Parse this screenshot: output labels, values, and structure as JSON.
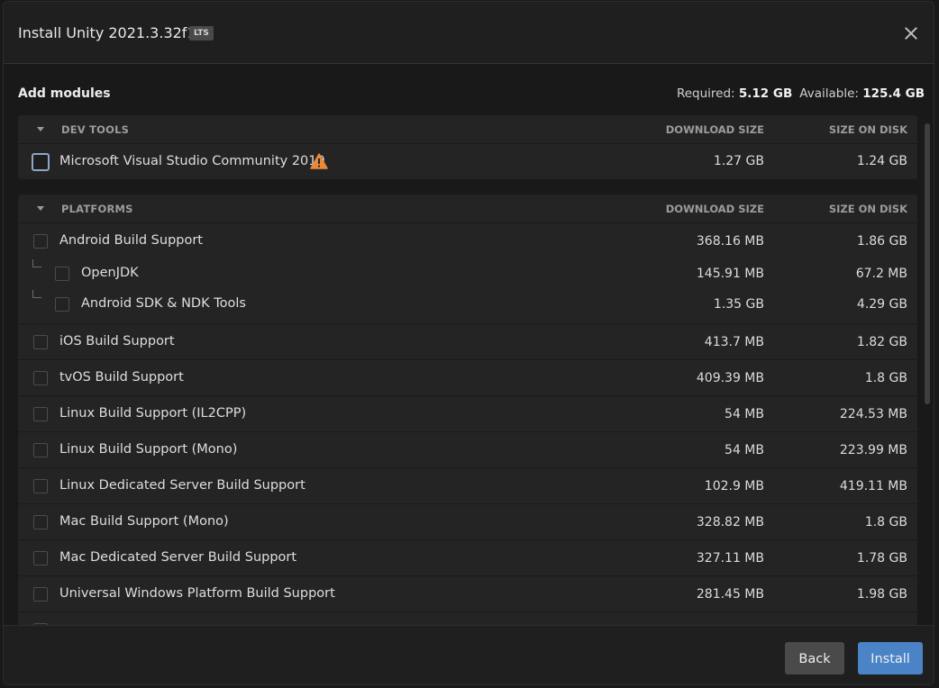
{
  "dialog": {
    "title": "Install Unity 2021.3.32f1",
    "badge": "LTS",
    "close_icon": "close-icon"
  },
  "summary": {
    "heading": "Add modules",
    "required_label": "Required:",
    "required_value": "5.12 GB",
    "available_label": "Available:",
    "available_value": "125.4 GB"
  },
  "dev_tools": {
    "header": "DEV TOOLS",
    "col_download": "DOWNLOAD SIZE",
    "col_disk": "SIZE ON DISK",
    "items": [
      {
        "label": "Microsoft Visual Studio Community 2019",
        "download": "1.27 GB",
        "disk": "1.24 GB",
        "icon": "warning-icon",
        "warning_color": "#e8883a"
      }
    ]
  },
  "platforms": {
    "header": "PLATFORMS",
    "col_download": "DOWNLOAD SIZE",
    "col_disk": "SIZE ON DISK",
    "items": [
      {
        "label": "Android Build Support",
        "download": "368.16 MB",
        "disk": "1.86 GB"
      },
      {
        "label": "OpenJDK",
        "download": "145.91 MB",
        "disk": "67.2 MB"
      },
      {
        "label": "Android SDK & NDK Tools",
        "download": "1.35 GB",
        "disk": "4.29 GB"
      },
      {
        "label": "iOS Build Support",
        "download": "413.7 MB",
        "disk": "1.82 GB"
      },
      {
        "label": "tvOS Build Support",
        "download": "409.39 MB",
        "disk": "1.8 GB"
      },
      {
        "label": "Linux Build Support (IL2CPP)",
        "download": "54 MB",
        "disk": "224.53 MB"
      },
      {
        "label": "Linux Build Support (Mono)",
        "download": "54 MB",
        "disk": "223.99 MB"
      },
      {
        "label": "Linux Dedicated Server Build Support",
        "download": "102.9 MB",
        "disk": "419.11 MB"
      },
      {
        "label": "Mac Build Support (Mono)",
        "download": "328.82 MB",
        "disk": "1.8 GB"
      },
      {
        "label": "Mac Dedicated Server Build Support",
        "download": "327.11 MB",
        "disk": "1.78 GB"
      },
      {
        "label": "Universal Windows Platform Build Support",
        "download": "281.45 MB",
        "disk": "1.98 GB"
      }
    ]
  },
  "footer": {
    "back_label": "Back",
    "install_label": "Install"
  },
  "colors": {
    "accent": "#4a83c6",
    "warning": "#e8883a"
  }
}
